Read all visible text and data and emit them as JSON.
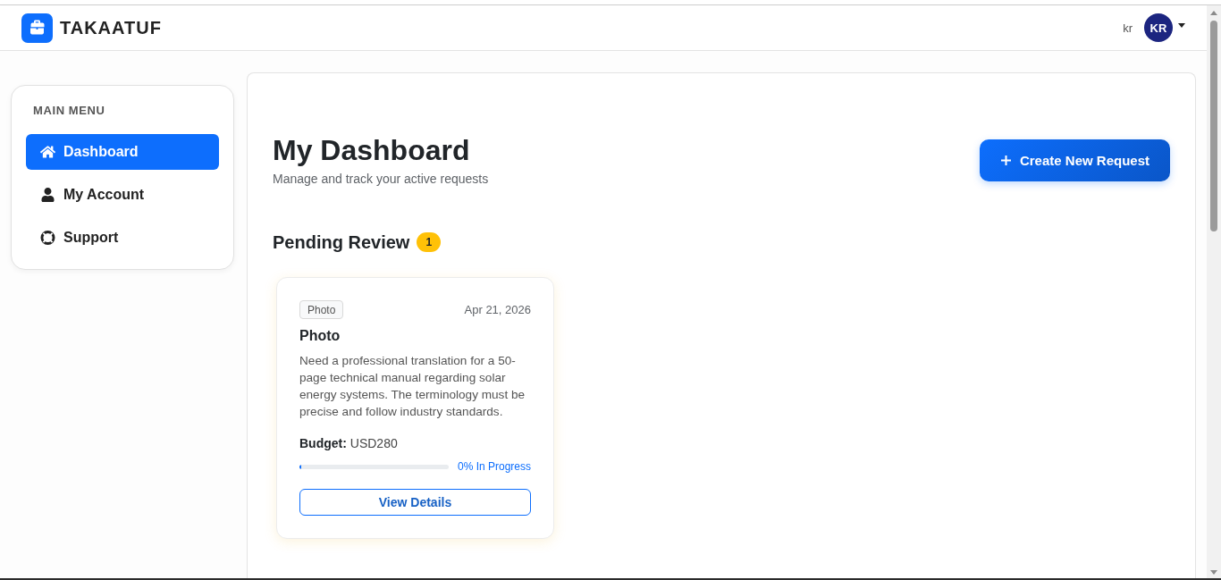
{
  "header": {
    "brand": "TAKAATUF",
    "user_name": "kr",
    "avatar_initials": "KR"
  },
  "sidebar": {
    "heading": "MAIN MENU",
    "items": [
      {
        "label": "Dashboard",
        "selected": true
      },
      {
        "label": "My Account",
        "selected": false
      },
      {
        "label": "Support",
        "selected": false
      }
    ]
  },
  "main": {
    "title": "My Dashboard",
    "subtitle": "Manage and track your active requests",
    "create_button": "Create New Request"
  },
  "sections": [
    {
      "title": "Pending Review",
      "count": "1",
      "requests": [
        {
          "tag": "Photo",
          "date": "Apr 21, 2026",
          "title": "Photo",
          "description": "Need a professional translation for a 50-page technical manual regarding solar energy systems. The terminology must be precise and follow industry standards.",
          "budget": "**Budget:** USD280",
          "progress": {
            "level": 0,
            "label": "0% In Progress"
          },
          "button": "View Details"
        }
      ]
    }
  ]
}
